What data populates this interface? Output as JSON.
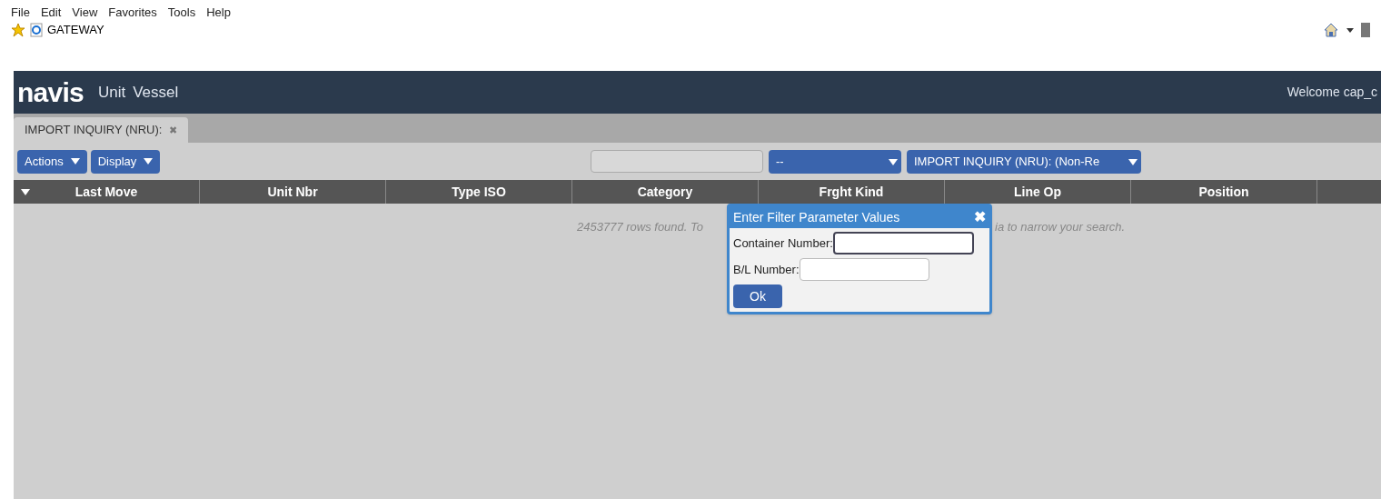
{
  "menu_bar": [
    "File",
    "Edit",
    "View",
    "Favorites",
    "Tools",
    "Help"
  ],
  "favorites_bar": {
    "link": "GATEWAY"
  },
  "header": {
    "logo": "navis",
    "nav": [
      "Unit",
      "Vessel"
    ],
    "welcome": "Welcome cap_c"
  },
  "tabs": [
    {
      "label": "IMPORT INQUIRY (NRU):",
      "close": "✖",
      "selected": true
    }
  ],
  "toolbar": {
    "buttons": [
      "Actions",
      "Display"
    ],
    "filter_select": "--",
    "view_select": "IMPORT INQUIRY (NRU): (Non-Re"
  },
  "table": {
    "columns": [
      "Last Move",
      "Unit Nbr",
      "Type ISO",
      "Category",
      "Frght Kind",
      "Line Op",
      "Position"
    ],
    "message_left": "2453777 rows found. To",
    "message_right": "ia to narrow your search."
  },
  "dialog": {
    "title": "Enter Filter Parameter Values",
    "close": "✖",
    "fields": [
      {
        "label": "Container Number:",
        "focused": true
      },
      {
        "label": "B/L Number:",
        "focused": false
      }
    ],
    "ok": "Ok"
  }
}
